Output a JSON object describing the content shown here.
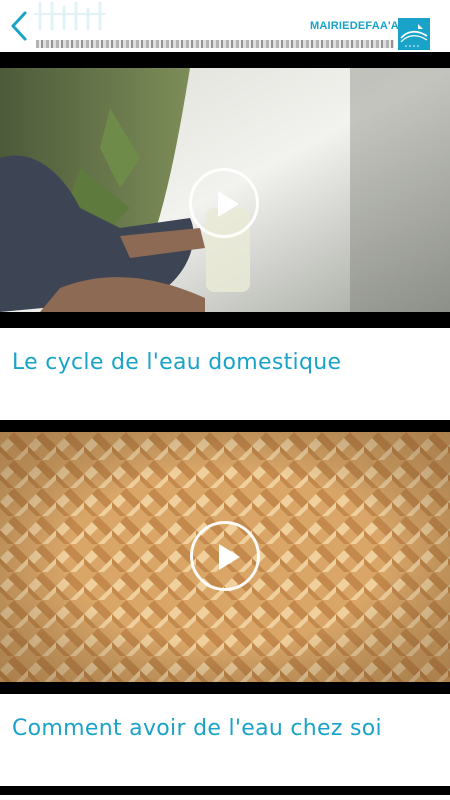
{
  "header": {
    "brand": "MAIRIEDEFAA'A",
    "colors": {
      "accent": "#1aa3c9"
    },
    "icons": {
      "back": "back-chevron-icon",
      "logo": "mairie-logo-icon"
    }
  },
  "videos": [
    {
      "title": "Le cycle de l'eau domestique",
      "play_icon": "play-icon"
    },
    {
      "title": "Comment avoir de l'eau chez soi",
      "play_icon": "play-icon"
    }
  ]
}
